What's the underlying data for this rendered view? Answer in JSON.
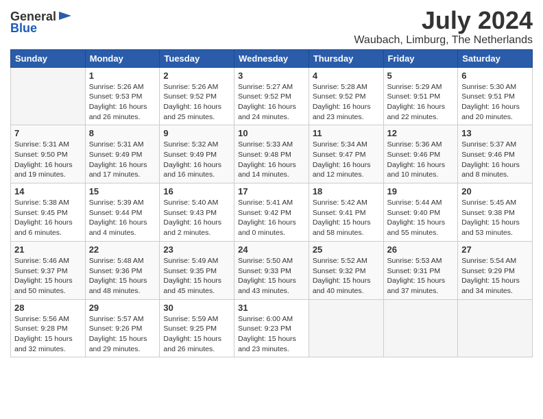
{
  "logo": {
    "general": "General",
    "blue": "Blue"
  },
  "title": "July 2024",
  "location": "Waubach, Limburg, The Netherlands",
  "days_of_week": [
    "Sunday",
    "Monday",
    "Tuesday",
    "Wednesday",
    "Thursday",
    "Friday",
    "Saturday"
  ],
  "weeks": [
    [
      {
        "day": "",
        "info": ""
      },
      {
        "day": "1",
        "info": "Sunrise: 5:26 AM\nSunset: 9:53 PM\nDaylight: 16 hours\nand 26 minutes."
      },
      {
        "day": "2",
        "info": "Sunrise: 5:26 AM\nSunset: 9:52 PM\nDaylight: 16 hours\nand 25 minutes."
      },
      {
        "day": "3",
        "info": "Sunrise: 5:27 AM\nSunset: 9:52 PM\nDaylight: 16 hours\nand 24 minutes."
      },
      {
        "day": "4",
        "info": "Sunrise: 5:28 AM\nSunset: 9:52 PM\nDaylight: 16 hours\nand 23 minutes."
      },
      {
        "day": "5",
        "info": "Sunrise: 5:29 AM\nSunset: 9:51 PM\nDaylight: 16 hours\nand 22 minutes."
      },
      {
        "day": "6",
        "info": "Sunrise: 5:30 AM\nSunset: 9:51 PM\nDaylight: 16 hours\nand 20 minutes."
      }
    ],
    [
      {
        "day": "7",
        "info": "Sunrise: 5:31 AM\nSunset: 9:50 PM\nDaylight: 16 hours\nand 19 minutes."
      },
      {
        "day": "8",
        "info": "Sunrise: 5:31 AM\nSunset: 9:49 PM\nDaylight: 16 hours\nand 17 minutes."
      },
      {
        "day": "9",
        "info": "Sunrise: 5:32 AM\nSunset: 9:49 PM\nDaylight: 16 hours\nand 16 minutes."
      },
      {
        "day": "10",
        "info": "Sunrise: 5:33 AM\nSunset: 9:48 PM\nDaylight: 16 hours\nand 14 minutes."
      },
      {
        "day": "11",
        "info": "Sunrise: 5:34 AM\nSunset: 9:47 PM\nDaylight: 16 hours\nand 12 minutes."
      },
      {
        "day": "12",
        "info": "Sunrise: 5:36 AM\nSunset: 9:46 PM\nDaylight: 16 hours\nand 10 minutes."
      },
      {
        "day": "13",
        "info": "Sunrise: 5:37 AM\nSunset: 9:46 PM\nDaylight: 16 hours\nand 8 minutes."
      }
    ],
    [
      {
        "day": "14",
        "info": "Sunrise: 5:38 AM\nSunset: 9:45 PM\nDaylight: 16 hours\nand 6 minutes."
      },
      {
        "day": "15",
        "info": "Sunrise: 5:39 AM\nSunset: 9:44 PM\nDaylight: 16 hours\nand 4 minutes."
      },
      {
        "day": "16",
        "info": "Sunrise: 5:40 AM\nSunset: 9:43 PM\nDaylight: 16 hours\nand 2 minutes."
      },
      {
        "day": "17",
        "info": "Sunrise: 5:41 AM\nSunset: 9:42 PM\nDaylight: 16 hours\nand 0 minutes."
      },
      {
        "day": "18",
        "info": "Sunrise: 5:42 AM\nSunset: 9:41 PM\nDaylight: 15 hours\nand 58 minutes."
      },
      {
        "day": "19",
        "info": "Sunrise: 5:44 AM\nSunset: 9:40 PM\nDaylight: 15 hours\nand 55 minutes."
      },
      {
        "day": "20",
        "info": "Sunrise: 5:45 AM\nSunset: 9:38 PM\nDaylight: 15 hours\nand 53 minutes."
      }
    ],
    [
      {
        "day": "21",
        "info": "Sunrise: 5:46 AM\nSunset: 9:37 PM\nDaylight: 15 hours\nand 50 minutes."
      },
      {
        "day": "22",
        "info": "Sunrise: 5:48 AM\nSunset: 9:36 PM\nDaylight: 15 hours\nand 48 minutes."
      },
      {
        "day": "23",
        "info": "Sunrise: 5:49 AM\nSunset: 9:35 PM\nDaylight: 15 hours\nand 45 minutes."
      },
      {
        "day": "24",
        "info": "Sunrise: 5:50 AM\nSunset: 9:33 PM\nDaylight: 15 hours\nand 43 minutes."
      },
      {
        "day": "25",
        "info": "Sunrise: 5:52 AM\nSunset: 9:32 PM\nDaylight: 15 hours\nand 40 minutes."
      },
      {
        "day": "26",
        "info": "Sunrise: 5:53 AM\nSunset: 9:31 PM\nDaylight: 15 hours\nand 37 minutes."
      },
      {
        "day": "27",
        "info": "Sunrise: 5:54 AM\nSunset: 9:29 PM\nDaylight: 15 hours\nand 34 minutes."
      }
    ],
    [
      {
        "day": "28",
        "info": "Sunrise: 5:56 AM\nSunset: 9:28 PM\nDaylight: 15 hours\nand 32 minutes."
      },
      {
        "day": "29",
        "info": "Sunrise: 5:57 AM\nSunset: 9:26 PM\nDaylight: 15 hours\nand 29 minutes."
      },
      {
        "day": "30",
        "info": "Sunrise: 5:59 AM\nSunset: 9:25 PM\nDaylight: 15 hours\nand 26 minutes."
      },
      {
        "day": "31",
        "info": "Sunrise: 6:00 AM\nSunset: 9:23 PM\nDaylight: 15 hours\nand 23 minutes."
      },
      {
        "day": "",
        "info": ""
      },
      {
        "day": "",
        "info": ""
      },
      {
        "day": "",
        "info": ""
      }
    ]
  ]
}
